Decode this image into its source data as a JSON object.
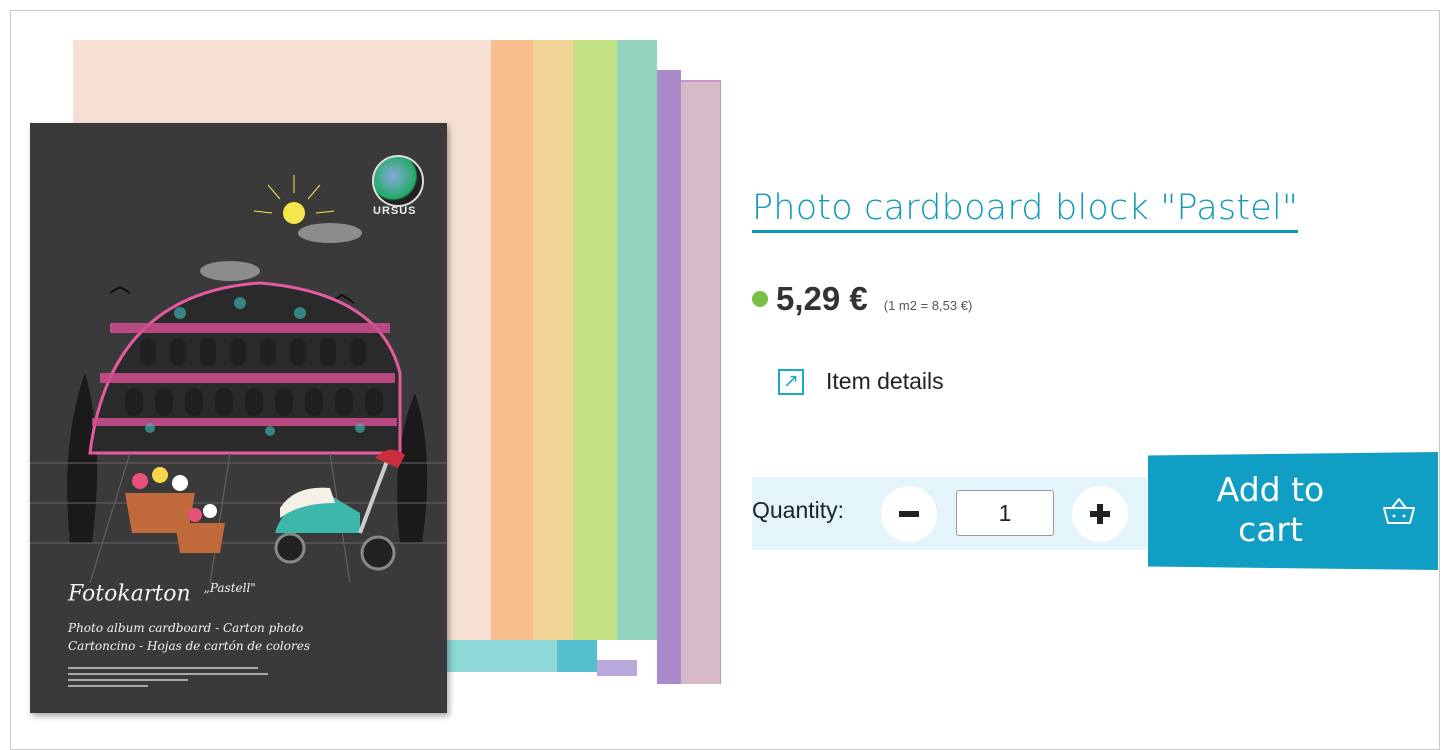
{
  "product": {
    "title": "Photo cardboard block \"Pastel\"",
    "price": "5,29 €",
    "unit_price": "(1 m2 = 8,53 €)",
    "stock_color": "#78c043"
  },
  "details_link": {
    "label": "Item details",
    "icon": "external-link-icon"
  },
  "quantity": {
    "label": "Quantity:",
    "value": "1",
    "minus_icon": "minus-icon",
    "plus_icon": "plus-icon"
  },
  "cart": {
    "label_line1": "Add to",
    "label_line2": "cart",
    "icon": "basket-icon",
    "color": "#109ec4"
  },
  "packaging": {
    "brand": "URSUS",
    "product_name": "Fotokarton",
    "variant": "„Pastell\"",
    "line1": "Photo album cardboard - Carton photo",
    "line2": "Cartoncino - Hojas de cartón de colores"
  },
  "accent": "#0e9ab8"
}
